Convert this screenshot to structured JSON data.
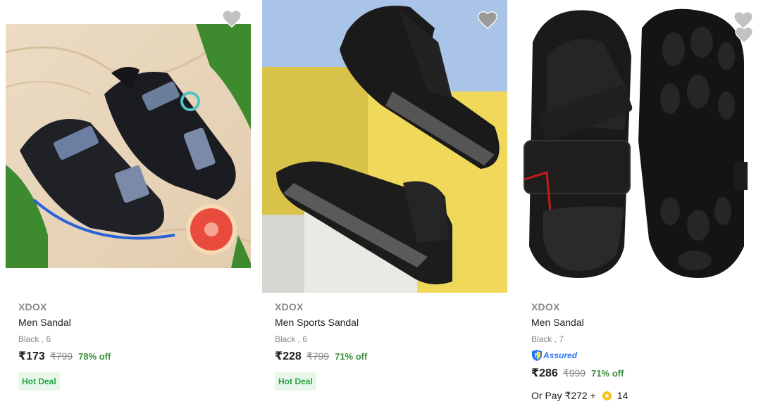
{
  "products": [
    {
      "brand": "XDOX",
      "title": "Men Sandal",
      "variant": "Black , 6",
      "price": "₹173",
      "mrp": "₹799",
      "discount": "78% off",
      "badge": "Hot Deal",
      "wishlist_icon": "heart-icon"
    },
    {
      "brand": "XDOX",
      "title": "Men Sports Sandal",
      "variant": "Black , 6",
      "price": "₹228",
      "mrp": "₹799",
      "discount": "71% off",
      "badge": "Hot Deal",
      "wishlist_icon": "heart-icon"
    },
    {
      "brand": "XDOX",
      "title": "Men Sandal",
      "variant": "Black , 7",
      "assured": "Assured",
      "price": "₹286",
      "mrp": "₹999",
      "discount": "71% off",
      "pay_prefix": "Or Pay ₹272 +",
      "coins": "14",
      "wishlist_icon": "heart-icon"
    }
  ],
  "colors": {
    "discount": "#388e3c",
    "deal_bg": "#e8f7ea",
    "deal_text": "#26a541",
    "assured_blue": "#2874f0"
  }
}
